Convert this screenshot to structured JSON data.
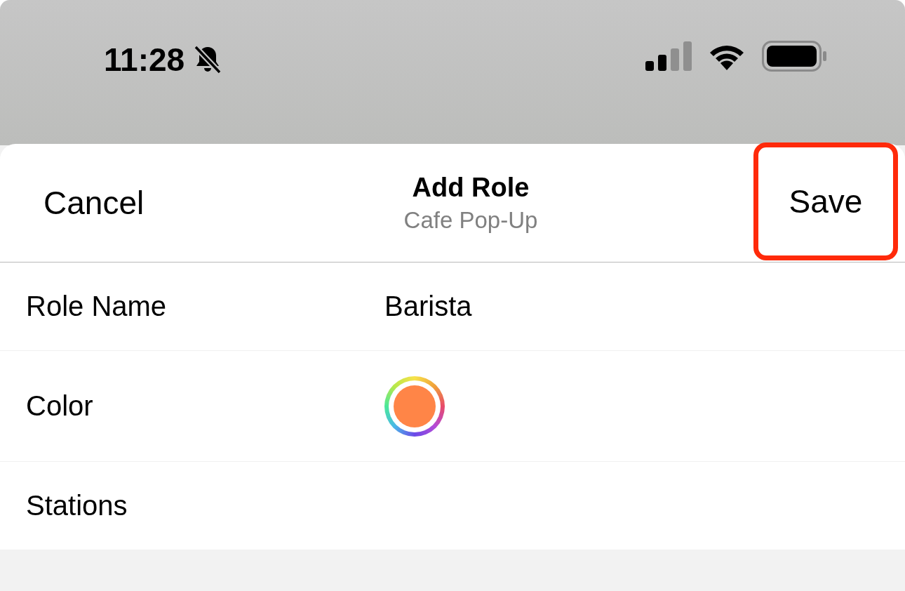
{
  "status_bar": {
    "time": "11:28"
  },
  "header": {
    "cancel": "Cancel",
    "title": "Add Role",
    "subtitle": "Cafe Pop-Up",
    "save": {
      "label": "Save",
      "highlighted": true
    }
  },
  "rows": [
    {
      "kind": "text",
      "label": "Role Name",
      "value": "Barista"
    },
    {
      "kind": "color",
      "label": "Color",
      "color": "#ff8547"
    },
    {
      "kind": "empty",
      "label": "Stations"
    }
  ]
}
